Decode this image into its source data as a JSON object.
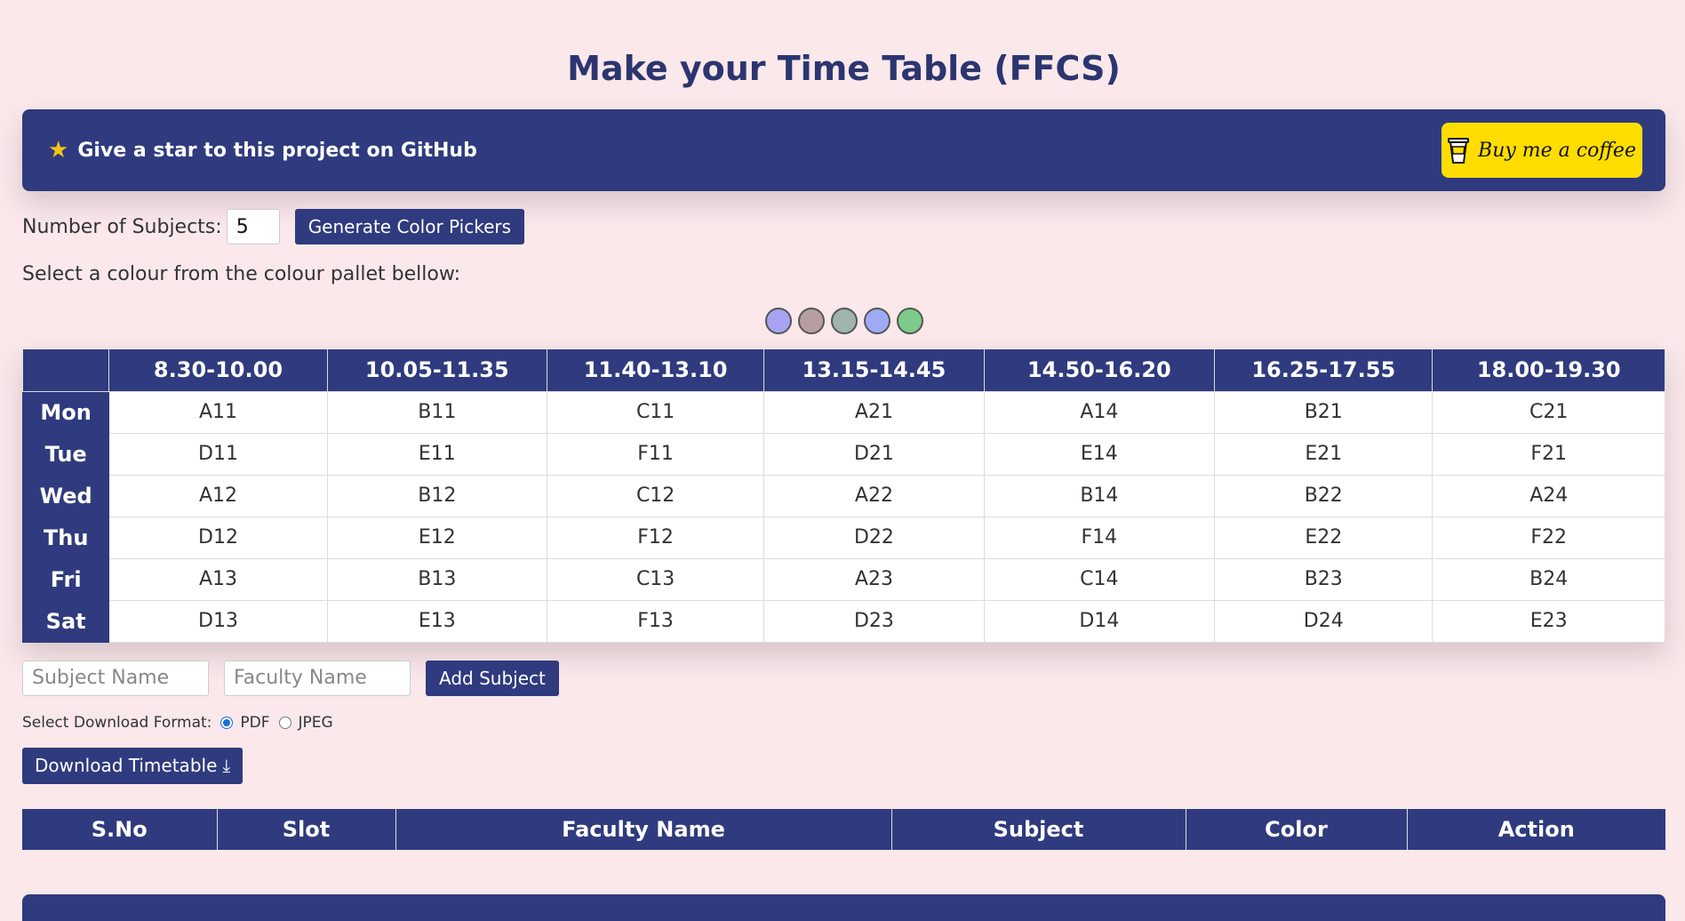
{
  "title": "Make your Time Table (FFCS)",
  "banner": {
    "github_text": "Give a star to this project on GitHub",
    "coffee_text": "Buy me a coffee"
  },
  "subjects": {
    "label": "Number of Subjects:",
    "value": "5",
    "generate_button": "Generate Color Pickers"
  },
  "pallet_text": "Select a colour from the colour pallet bellow:",
  "pallet_colors": [
    "#a7a2f2",
    "#b69ea0",
    "#9fb4ab",
    "#9dabf5",
    "#7ccb8a"
  ],
  "timetable": {
    "times": [
      "8.30-10.00",
      "10.05-11.35",
      "11.40-13.10",
      "13.15-14.45",
      "14.50-16.20",
      "16.25-17.55",
      "18.00-19.30"
    ],
    "rows": [
      {
        "day": "Mon",
        "slots": [
          "A11",
          "B11",
          "C11",
          "A21",
          "A14",
          "B21",
          "C21"
        ]
      },
      {
        "day": "Tue",
        "slots": [
          "D11",
          "E11",
          "F11",
          "D21",
          "E14",
          "E21",
          "F21"
        ]
      },
      {
        "day": "Wed",
        "slots": [
          "A12",
          "B12",
          "C12",
          "A22",
          "B14",
          "B22",
          "A24"
        ]
      },
      {
        "day": "Thu",
        "slots": [
          "D12",
          "E12",
          "F12",
          "D22",
          "F14",
          "E22",
          "F22"
        ]
      },
      {
        "day": "Fri",
        "slots": [
          "A13",
          "B13",
          "C13",
          "A23",
          "C14",
          "B23",
          "B24"
        ]
      },
      {
        "day": "Sat",
        "slots": [
          "D13",
          "E13",
          "F13",
          "D23",
          "D14",
          "D24",
          "E23"
        ]
      }
    ]
  },
  "add_subject": {
    "subject_placeholder": "Subject Name",
    "faculty_placeholder": "Faculty Name",
    "button": "Add Subject"
  },
  "download": {
    "format_label": "Select Download Format:",
    "options": [
      "PDF",
      "JPEG"
    ],
    "selected": "PDF",
    "button": "Download Timetable"
  },
  "subjects_table": {
    "headers": [
      "S.No",
      "Slot",
      "Faculty Name",
      "Subject",
      "Color",
      "Action"
    ]
  },
  "colors": {
    "primary": "#2f3b7e",
    "background": "#fae8ea",
    "coffee": "#ffdd00",
    "star": "#f5c518"
  }
}
